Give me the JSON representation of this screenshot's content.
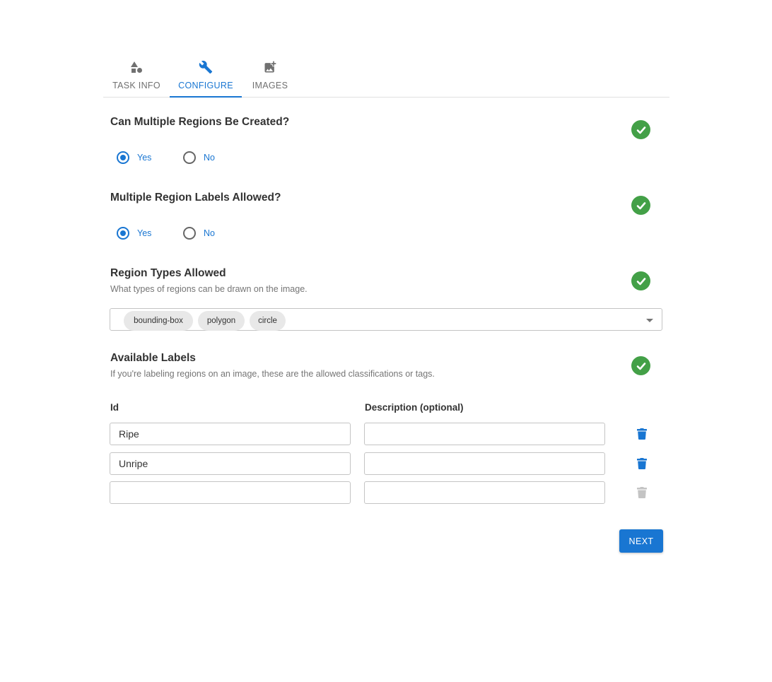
{
  "tabs": [
    {
      "label": "TASK INFO",
      "icon": "shapes-icon",
      "active": false
    },
    {
      "label": "CONFIGURE",
      "icon": "wrench-icon",
      "active": true
    },
    {
      "label": "IMAGES",
      "icon": "add-photo-icon",
      "active": false
    }
  ],
  "sections": {
    "multiple_regions": {
      "title": "Can Multiple Regions Be Created?",
      "options": [
        "Yes",
        "No"
      ],
      "selected": "Yes"
    },
    "multiple_labels": {
      "title": "Multiple Region Labels Allowed?",
      "options": [
        "Yes",
        "No"
      ],
      "selected": "Yes"
    },
    "region_types": {
      "title": "Region Types Allowed",
      "description": "What types of regions can be drawn on the image.",
      "chips": [
        "bounding-box",
        "polygon",
        "circle"
      ]
    },
    "available_labels": {
      "title": "Available Labels",
      "description": "If you're labeling regions on an image, these are the allowed classifications or tags."
    }
  },
  "labels_table": {
    "col_id": "Id",
    "col_description": "Description (optional)",
    "rows": [
      {
        "id": "Ripe",
        "description": "",
        "deletable": true
      },
      {
        "id": "Unripe",
        "description": "",
        "deletable": true
      },
      {
        "id": "",
        "description": "",
        "deletable": false
      }
    ]
  },
  "next_label": "NEXT",
  "colors": {
    "accent": "#1976d2",
    "success": "#43a047",
    "disabled_icon": "#c4c4c4"
  }
}
